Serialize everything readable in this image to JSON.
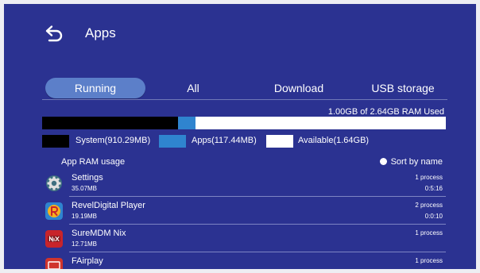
{
  "header": {
    "title": "Apps",
    "back_icon": "back-arrow-icon"
  },
  "tabs": [
    {
      "label": "Running",
      "active": true
    },
    {
      "label": "All",
      "active": false
    },
    {
      "label": "Download",
      "active": false
    },
    {
      "label": "USB storage",
      "active": false
    }
  ],
  "ram": {
    "summary": "1.00GB of 2.64GB RAM Used",
    "system_fraction": 0.337,
    "apps_fraction": 0.043,
    "available_fraction": 0.62,
    "legend": {
      "system": "System(910.29MB)",
      "apps": "Apps(117.44MB)",
      "available": "Available(1.64GB)"
    },
    "colors": {
      "system": "#000000",
      "apps": "#2f84cf",
      "available": "#ffffff"
    }
  },
  "list": {
    "title": "App RAM usage",
    "sort_label": "Sort by name",
    "apps": [
      {
        "name": "Settings",
        "size": "35.07MB",
        "processes": "1 process",
        "time": "0:5:16",
        "icon": "gear-icon"
      },
      {
        "name": "RevelDigital Player",
        "size": "19.19MB",
        "processes": "2 process",
        "time": "0:0:10",
        "icon": "reveldigital-logo-icon"
      },
      {
        "name": "SureMDM Nix",
        "size": "12.71MB",
        "processes": "1 process",
        "time": "",
        "icon": "nix-logo-icon"
      },
      {
        "name": "FAirplay",
        "size": "",
        "processes": "1 process",
        "time": "",
        "icon": "airplay-icon"
      }
    ]
  }
}
